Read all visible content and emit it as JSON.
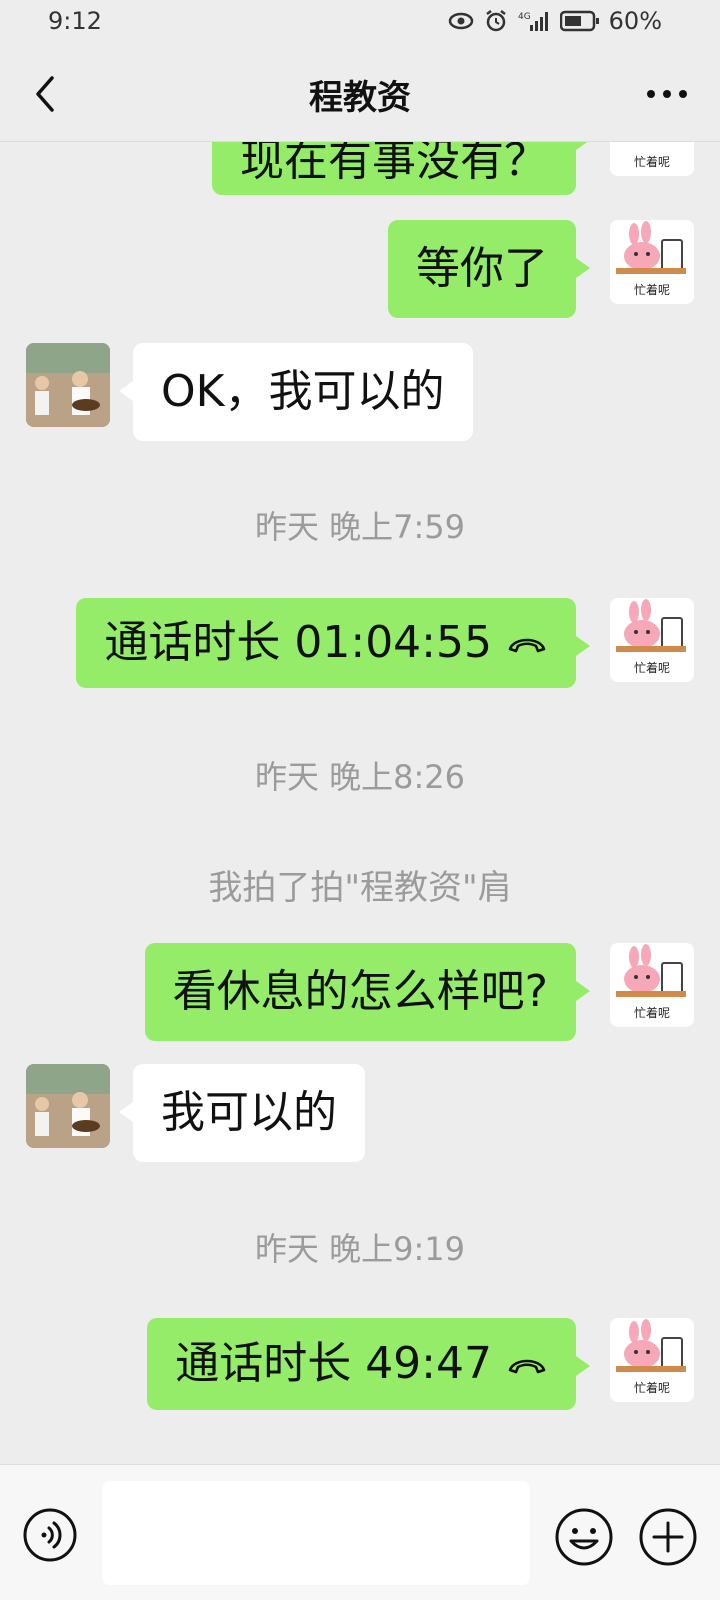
{
  "status_bar": {
    "time": "9:12",
    "battery_percent": "60%",
    "network": "4G"
  },
  "header": {
    "title": "程教资",
    "back_icon": "back-arrow-icon",
    "more_icon": "more-icon"
  },
  "messages": [
    {
      "type": "sent",
      "text": "现在有事没有？"
    },
    {
      "type": "sent",
      "text": "等你了"
    },
    {
      "type": "received",
      "text": "OK，我可以的"
    },
    {
      "type": "timestamp",
      "text": "昨天 晚上7:59"
    },
    {
      "type": "sent_call",
      "text": "通话时长 01:04:55"
    },
    {
      "type": "timestamp",
      "text": "昨天 晚上8:26"
    },
    {
      "type": "system",
      "text": "我拍了拍\"程教资\"肩"
    },
    {
      "type": "sent",
      "text": "看休息的怎么样吧?"
    },
    {
      "type": "received",
      "text": "我可以的"
    },
    {
      "type": "timestamp",
      "text": "昨天 晚上9:19"
    },
    {
      "type": "sent_call",
      "text": "通话时长 49:47"
    }
  ],
  "input_bar": {
    "voice_icon": "voice-icon",
    "emoji_icon": "emoji-icon",
    "plus_icon": "plus-icon",
    "input_value": ""
  },
  "avatar_caption": "忙着呢"
}
